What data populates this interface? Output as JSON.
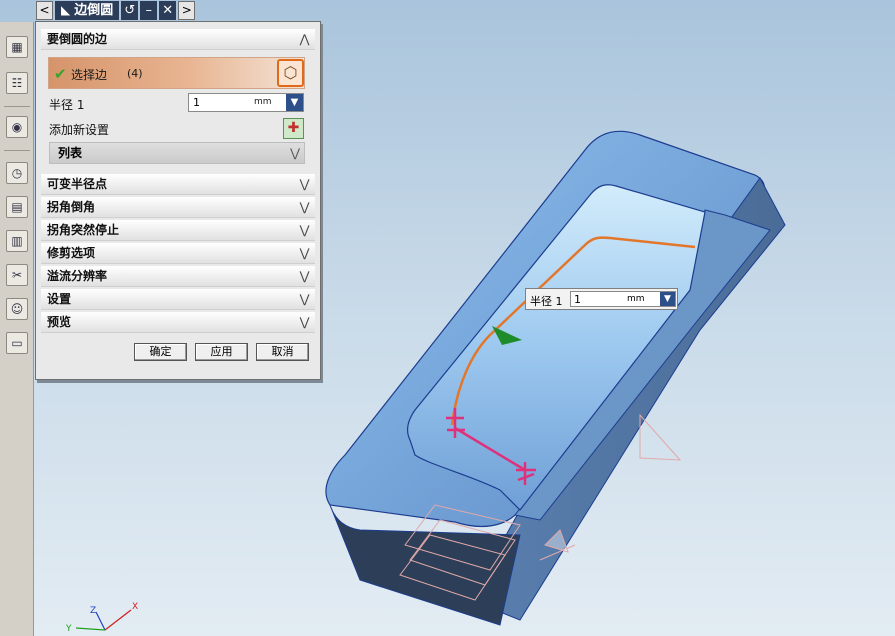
{
  "title_tab": {
    "title": "边倒圆",
    "nav_left": "<",
    "nav_right": ">",
    "reset": "↺",
    "minimize": "–",
    "close": "✕"
  },
  "dialog": {
    "sections": {
      "edges": "要倒圆的边",
      "variable_radius": "可变半径点",
      "corner_setback": "拐角倒角",
      "corner_stop": "拐角突然停止",
      "trim": "修剪选项",
      "overflow": "溢流分辨率",
      "settings": "设置",
      "preview": "预览"
    },
    "select_edge": {
      "label": "选择边",
      "count": "(4)"
    },
    "radius": {
      "label": "半径 1",
      "value": "1",
      "unit": "mm"
    },
    "add_set": {
      "label": "添加新设置"
    },
    "list": {
      "label": "列表"
    },
    "buttons": {
      "ok": "确定",
      "apply": "应用",
      "cancel": "取消"
    }
  },
  "float_tag": {
    "label": "半径 1",
    "value": "1",
    "unit": "mm"
  },
  "axes": {
    "x": "X",
    "y": "Y",
    "z": "Z"
  },
  "colors": {
    "body_blue": "#5f8fc8",
    "edge_orange": "#e2772c",
    "handle_pink": "#e0307a",
    "title_dark": "#2c3d5a"
  }
}
